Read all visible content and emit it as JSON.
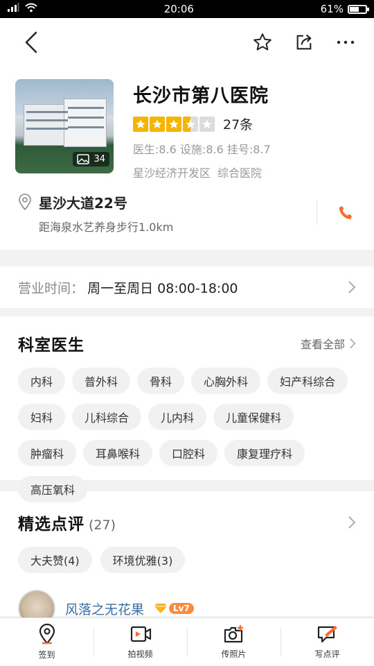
{
  "status": {
    "time": "20:06",
    "battery": "61%",
    "battery_level": 0.61
  },
  "hospital": {
    "name": "长沙市第八医院",
    "rating_stars": 3.5,
    "review_count": "27条",
    "scores": "医生:8.6 设施:8.6 挂号:8.7",
    "district": "星沙经济开发区",
    "category": "综合医院",
    "photo_count": "34"
  },
  "address": {
    "street": "星沙大道22号",
    "distance": "距海泉水艺养身步行1.0km"
  },
  "hours": {
    "label": "营业时间：",
    "value": "周一至周日 08:00-18:00"
  },
  "departments": {
    "title": "科室医生",
    "view_all": "查看全部",
    "tags": [
      "内科",
      "普外科",
      "骨科",
      "心胸外科",
      "妇产科综合",
      "妇科",
      "儿科综合",
      "儿内科",
      "儿童保健科",
      "肿瘤科",
      "耳鼻喉科",
      "口腔科",
      "康复理疗科",
      "高压氧科"
    ]
  },
  "reviews": {
    "title": "精选点评",
    "count": "(27)",
    "tags": [
      "大夫赞(4)",
      "环境优雅(3)"
    ],
    "first_user": {
      "name": "风落之无花果",
      "level": "Lv7"
    }
  },
  "tabbar": {
    "items": [
      {
        "label": "签到",
        "icon": "location-pin-icon"
      },
      {
        "label": "拍视频",
        "icon": "video-icon"
      },
      {
        "label": "传照片",
        "icon": "camera-plus-icon"
      },
      {
        "label": "写点评",
        "icon": "edit-review-icon"
      }
    ]
  },
  "colors": {
    "accent": "#f5b400",
    "phone": "#ff6a2b",
    "link": "#3a6ea5"
  }
}
